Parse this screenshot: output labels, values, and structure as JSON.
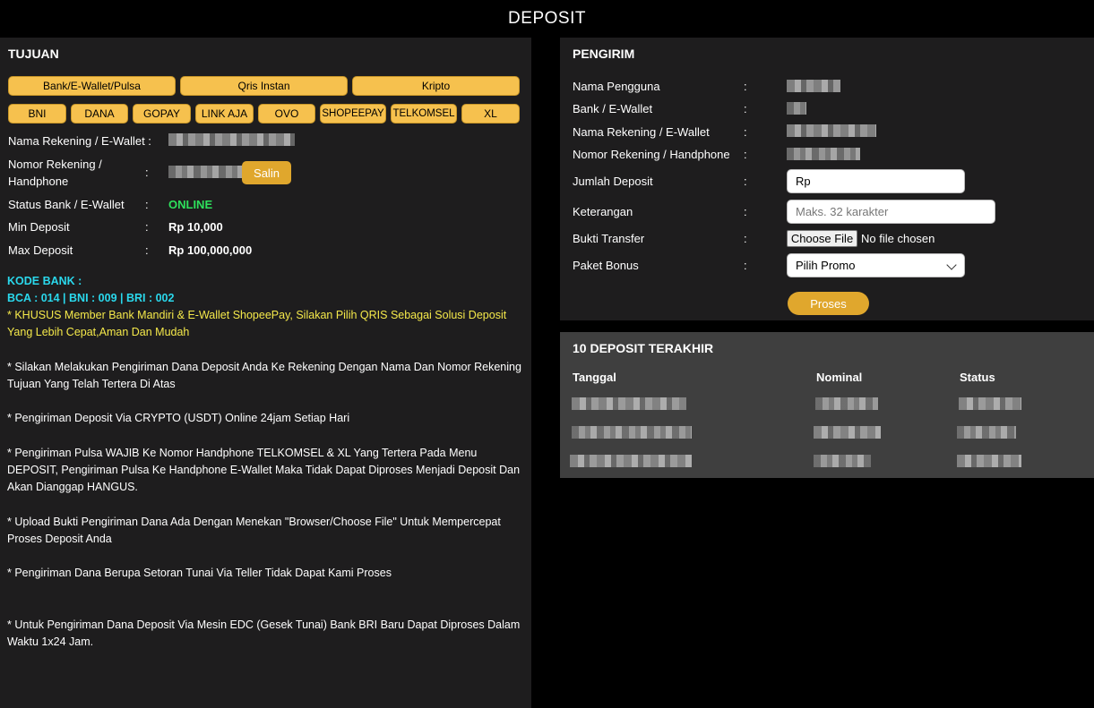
{
  "header": {
    "title": "DEPOSIT"
  },
  "tujuan": {
    "title": "TUJUAN",
    "tabs": [
      "Bank/E-Wallet/Pulsa",
      "Qris Instan",
      "Kripto"
    ],
    "banks": [
      "BNI",
      "DANA",
      "GOPAY",
      "LINK AJA",
      "OVO",
      "SHOPEEPAY",
      "TELKOMSEL",
      "XL"
    ],
    "fields": {
      "nama_label": "Nama Rekening / E-Wallet :",
      "nomor_label_1": "Nomor Rekening /",
      "nomor_label_2": "Handphone",
      "status_label": "Status Bank / E-Wallet",
      "status_value": "ONLINE",
      "min_label": "Min Deposit",
      "min_value": "Rp 10,000",
      "max_label": "Max Deposit",
      "max_value": "Rp 100,000,000",
      "colon": ":"
    },
    "copy_button": "Salin",
    "kode_bank_title": "KODE BANK :",
    "kode_bank_value": "BCA : 014 | BNI : 009 | BRI : 002",
    "notes": {
      "khusus": "* KHUSUS Member Bank Mandiri & E-Wallet ShopeePay, Silakan Pilih QRIS Sebagai Solusi Deposit Yang Lebih Cepat,Aman Dan Mudah",
      "n1": "* Silakan Melakukan Pengiriman Dana Deposit Anda Ke Rekening Dengan Nama Dan Nomor Rekening Tujuan Yang Telah Tertera Di Atas",
      "n2": "* Pengiriman Deposit Via CRYPTO (USDT) Online 24jam Setiap Hari",
      "n3": "* Pengiriman Pulsa WAJIB Ke Nomor Handphone TELKOMSEL & XL Yang Tertera Pada Menu DEPOSIT, Pengiriman Pulsa Ke Handphone E-Wallet Maka Tidak Dapat Diproses Menjadi Deposit Dan Akan Dianggap HANGUS.",
      "n4": "* Upload Bukti Pengiriman Dana Ada Dengan Menekan \"Browser/Choose File\" Untuk Mempercepat Proses Deposit Anda",
      "n5": "* Pengiriman Dana Berupa Setoran Tunai Via Teller Tidak Dapat Kami Proses",
      "n6": "* Untuk Pengiriman Dana Deposit Via Mesin EDC (Gesek Tunai) Bank BRI Baru Dapat Diproses Dalam Waktu 1x24 Jam."
    }
  },
  "pengirim": {
    "title": "PENGIRIM",
    "labels": [
      "Nama Pengguna",
      "Bank / E-Wallet",
      "Nama Rekening / E-Wallet",
      "Nomor Rekening / Handphone",
      "Jumlah Deposit",
      "Keterangan",
      "Bukti Transfer",
      "Paket Bonus"
    ],
    "colon": ":",
    "jumlah_value": "Rp",
    "keterangan_placeholder": "Maks. 32 karakter",
    "file_button": "Choose File",
    "file_status": "No file chosen",
    "promo_selected": "Pilih Promo",
    "submit": "Proses"
  },
  "history": {
    "title": "10 DEPOSIT TERAKHIR",
    "columns": [
      "Tanggal",
      "Nominal",
      "Status"
    ]
  },
  "colors": {
    "accent": "#f6c14e",
    "button_dark": "#e0a72d",
    "online": "#2ee05c",
    "cyan": "#2ad8ec",
    "note_yellow": "#f5e94a"
  }
}
